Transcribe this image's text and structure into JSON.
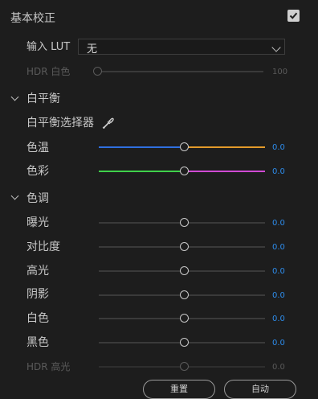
{
  "section_title": "基本校正",
  "enabled": true,
  "input_lut": {
    "label": "输入 LUT",
    "value": "无"
  },
  "hdr_white": {
    "label": "HDR 白色",
    "value": "100",
    "level": 0.0
  },
  "white_balance": {
    "header": "白平衡",
    "picker_label": "白平衡选择器",
    "temperature": {
      "label": "色温",
      "value": "0.0",
      "colors": [
        "#2f6fe0",
        "#e39a2a"
      ]
    },
    "tint": {
      "label": "色彩",
      "value": "0.0",
      "colors": [
        "#3fd14a",
        "#d04ad4"
      ]
    }
  },
  "tone": {
    "header": "色调",
    "sliders": [
      {
        "label": "曝光",
        "value": "0.0"
      },
      {
        "label": "对比度",
        "value": "0.0"
      },
      {
        "label": "高光",
        "value": "0.0"
      },
      {
        "label": "阴影",
        "value": "0.0"
      },
      {
        "label": "白色",
        "value": "0.0"
      },
      {
        "label": "黑色",
        "value": "0.0"
      }
    ],
    "hdr_highlights": {
      "label": "HDR 高光",
      "value": "0.0"
    }
  },
  "buttons": {
    "reset": "重置",
    "auto": "自动"
  }
}
